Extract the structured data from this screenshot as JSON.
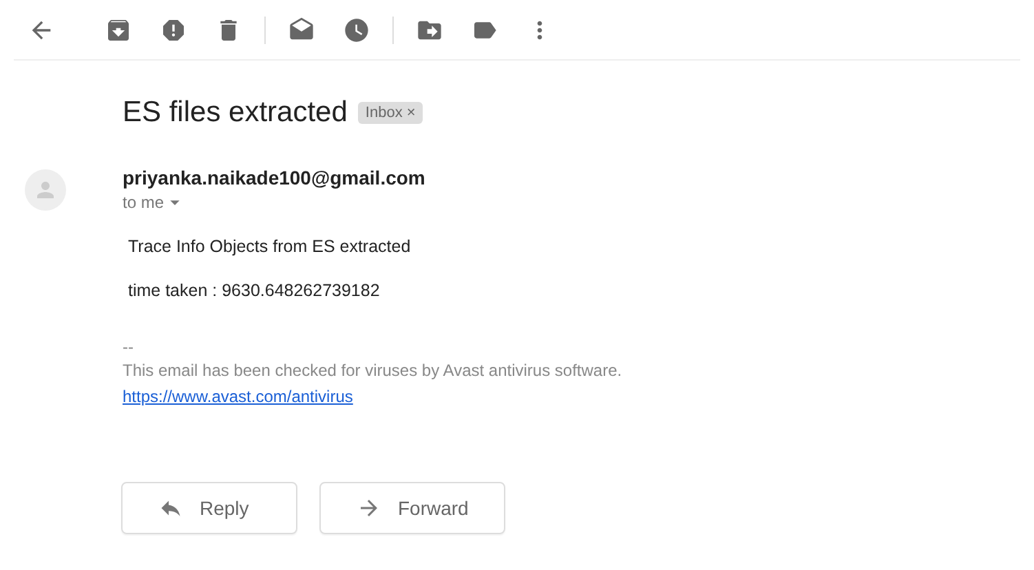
{
  "subject": "ES files extracted",
  "label": {
    "text": "Inbox",
    "close": "×"
  },
  "sender": "priyanka.naikade100@gmail.com",
  "recipient": "to me",
  "body": [
    "Trace Info Objects from ES extracted",
    "time taken : 9630.648262739182"
  ],
  "signature": {
    "separator": "--",
    "text": "This email has been checked for viruses by Avast antivirus software.",
    "link": "https://www.avast.com/antivirus"
  },
  "actions": [
    {
      "kind": "reply",
      "label": "Reply"
    },
    {
      "kind": "forward",
      "label": "Forward"
    }
  ]
}
